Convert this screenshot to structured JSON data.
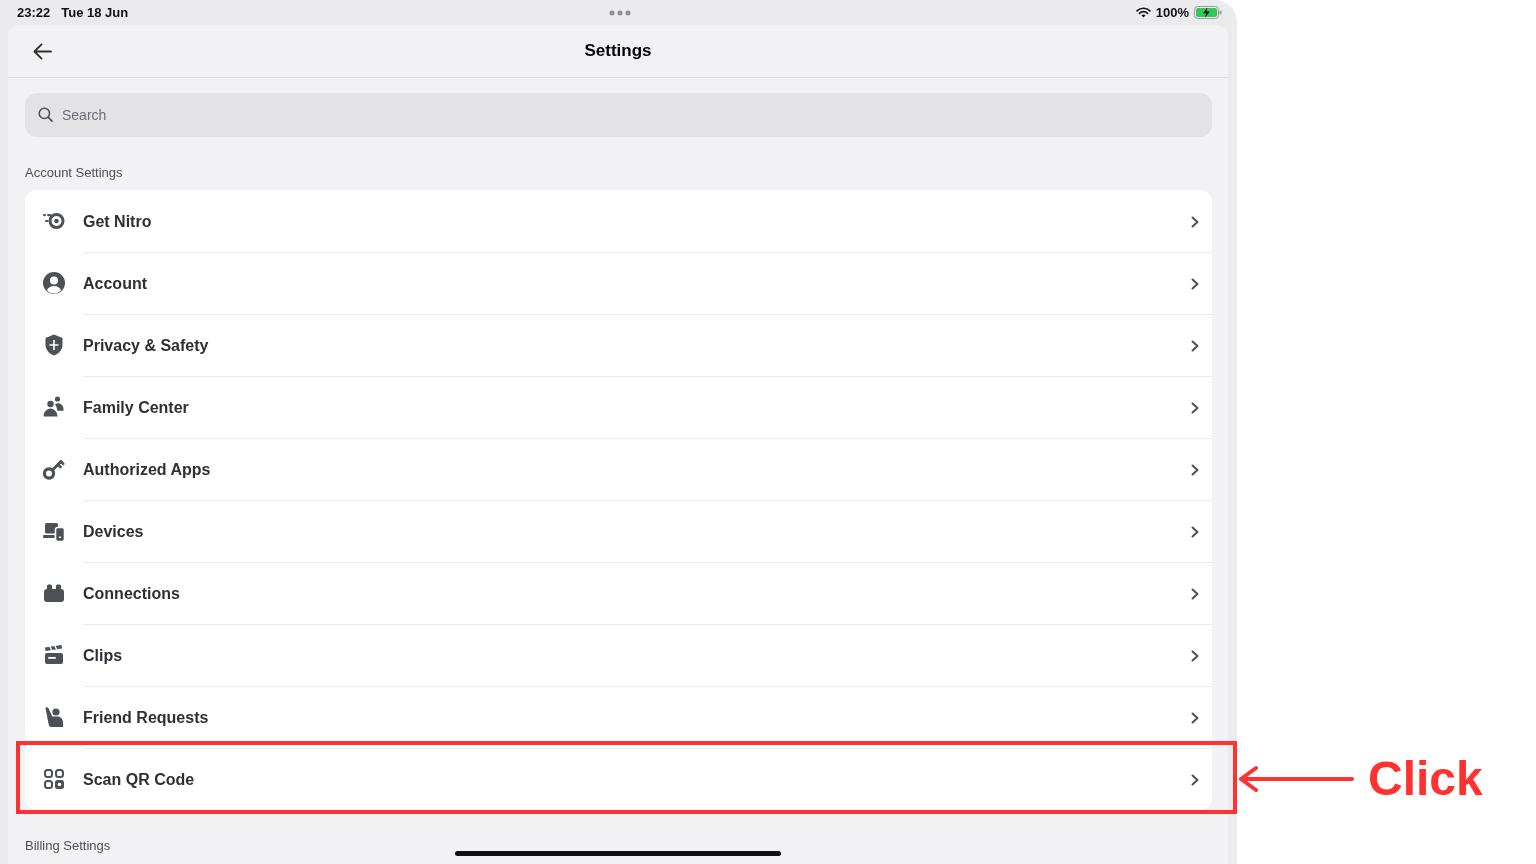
{
  "status_bar": {
    "time": "23:22",
    "date": "Tue 18 Jun",
    "battery": "100%"
  },
  "header": {
    "title": "Settings"
  },
  "search": {
    "placeholder": "Search"
  },
  "sections": [
    {
      "title": "Account Settings",
      "items": [
        {
          "label": "Get Nitro",
          "highlighted": false
        },
        {
          "label": "Account",
          "highlighted": false
        },
        {
          "label": "Privacy & Safety",
          "highlighted": false
        },
        {
          "label": "Family Center",
          "highlighted": false
        },
        {
          "label": "Authorized Apps",
          "highlighted": false
        },
        {
          "label": "Devices",
          "highlighted": false
        },
        {
          "label": "Connections",
          "highlighted": false
        },
        {
          "label": "Clips",
          "highlighted": false
        },
        {
          "label": "Friend Requests",
          "highlighted": false
        },
        {
          "label": "Scan QR Code",
          "highlighted": true
        }
      ]
    },
    {
      "title": "Billing Settings"
    }
  ],
  "annotation": {
    "label": "Click"
  }
}
